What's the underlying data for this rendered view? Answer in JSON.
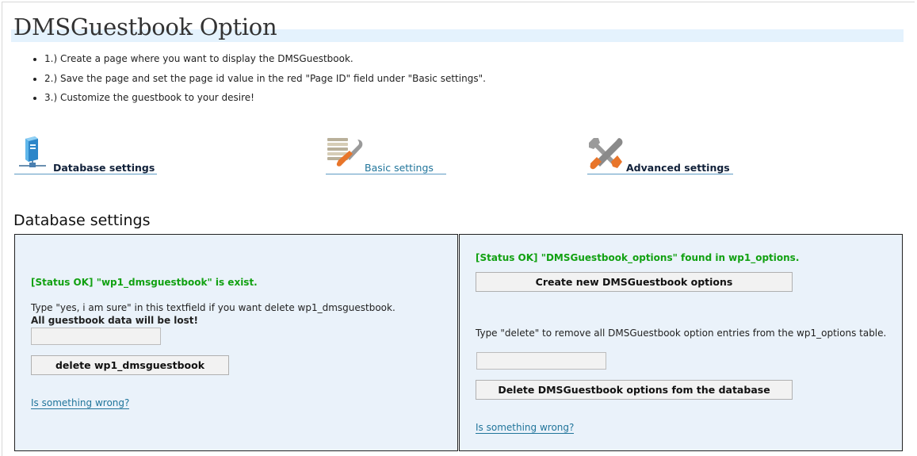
{
  "page": {
    "title": "DMSGuestbook Option"
  },
  "steps": [
    "1.) Create a page where you want to display the DMSGuestbook.",
    "2.) Save the page and set the page id value in the red \"Page ID\" field under \"Basic settings\".",
    "3.) Customize the guestbook to your desire!"
  ],
  "nav": {
    "database": {
      "label": "Database settings",
      "icon": "database-server-icon"
    },
    "basic": {
      "label": "Basic settings",
      "icon": "settings-list-wrench-icon"
    },
    "advanced": {
      "label": "Advanced settings",
      "icon": "screwdriver-wrench-icon"
    }
  },
  "section": {
    "title": "Database settings"
  },
  "left_panel": {
    "status": "[Status OK] \"wp1_dmsguestbook\" is exist.",
    "instruction": "Type \"yes, i am sure\" in this textfield if you want delete wp1_dmsguestbook.",
    "warning": "All guestbook data will be lost!",
    "input_value": "",
    "button": "delete wp1_dmsguestbook",
    "help_link": "Is something wrong?"
  },
  "right_panel": {
    "status": "[Status OK] \"DMSGuestbook_options\" found in wp1_options.",
    "create_button": "Create new DMSGuestbook options",
    "instruction": "Type \"delete\" to remove all DMSGuestbook option entries from the wp1_options table.",
    "input_value": "",
    "delete_button": "Delete DMSGuestbook options fom the database",
    "help_link": "Is something wrong?"
  },
  "colors": {
    "status_ok": "#12a112",
    "link": "#21759b",
    "panel_bg": "#eaf2fa",
    "title_bar": "#e4f2fd"
  }
}
